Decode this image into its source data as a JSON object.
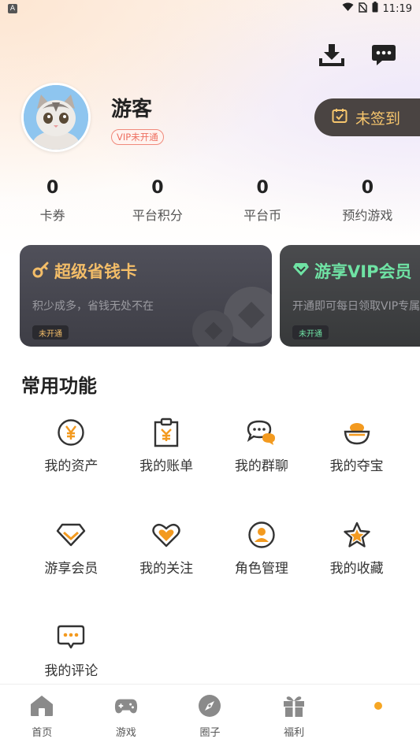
{
  "status_bar": {
    "time": "11:19",
    "app_icon": "A"
  },
  "header": {
    "download_icon": "download-icon",
    "message_icon": "message-icon"
  },
  "profile": {
    "username": "游客",
    "vip_status": "VIP未开通",
    "checkin_label": "未签到"
  },
  "stats": [
    {
      "value": "0",
      "label": "卡券"
    },
    {
      "value": "0",
      "label": "平台积分"
    },
    {
      "value": "0",
      "label": "平台币"
    },
    {
      "value": "0",
      "label": "预约游戏"
    }
  ],
  "cards": [
    {
      "title": "超级省钱卡",
      "desc": "积少成多，省钱无处不在",
      "tag": "未开通",
      "icon": "key-icon"
    },
    {
      "title": "游享VIP会员",
      "desc": "开通即可每日领取VIP专属福利",
      "tag": "未开通",
      "icon": "diamond-icon"
    }
  ],
  "section": {
    "title": "常用功能"
  },
  "functions": [
    {
      "label": "我的资产",
      "icon": "yen-coin-icon"
    },
    {
      "label": "我的账单",
      "icon": "bill-icon"
    },
    {
      "label": "我的群聊",
      "icon": "chat-group-icon"
    },
    {
      "label": "我的夺宝",
      "icon": "treasure-bowl-icon"
    },
    {
      "label": "游享会员",
      "icon": "vip-diamond-icon"
    },
    {
      "label": "我的关注",
      "icon": "heart-icon"
    },
    {
      "label": "角色管理",
      "icon": "user-icon"
    },
    {
      "label": "我的收藏",
      "icon": "star-icon"
    },
    {
      "label": "我的评论",
      "icon": "comment-icon"
    }
  ],
  "bottom_nav": [
    {
      "label": "首页",
      "icon": "home-icon"
    },
    {
      "label": "游戏",
      "icon": "gamepad-icon"
    },
    {
      "label": "圈子",
      "icon": "compass-icon"
    },
    {
      "label": "福利",
      "icon": "gift-icon"
    },
    {
      "label": "",
      "icon": "dot-icon"
    }
  ],
  "colors": {
    "accent": "#f6a623",
    "icon_dark": "#3a3a3a",
    "checkin_bg": "#4a4442",
    "checkin_text": "#f7c66d",
    "card_gold": "#f3bd68",
    "card_green": "#6fe3a4"
  }
}
